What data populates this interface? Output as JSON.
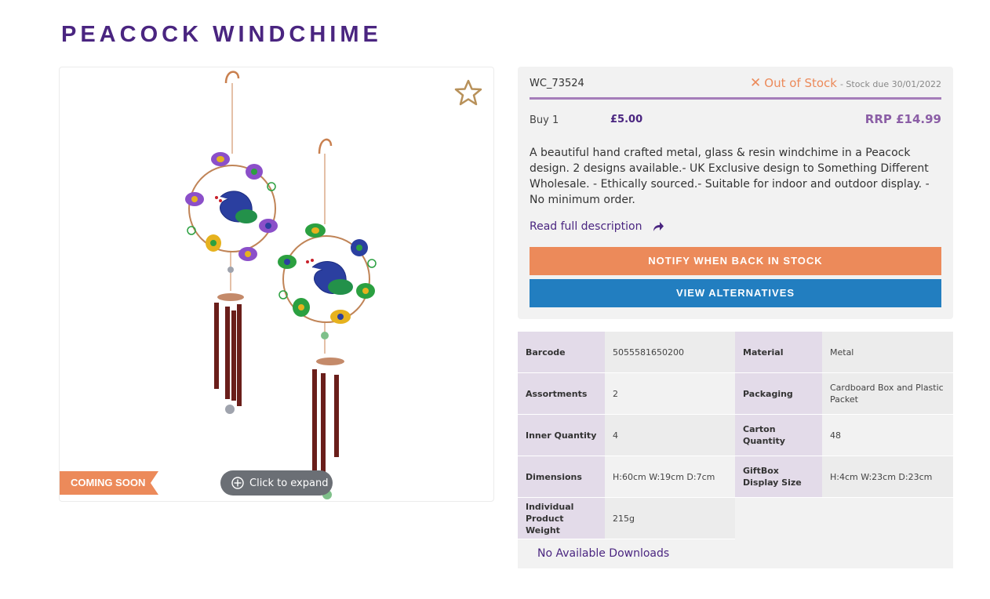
{
  "product": {
    "title": "PEACOCK WINDCHIME",
    "sku": "WC_73524",
    "stock_status": "Out of Stock",
    "stock_due": "- Stock due 30/01/2022",
    "buy_label": "Buy 1",
    "buy_price": "£5.00",
    "rrp": "RRP £14.99",
    "description": "A beautiful hand crafted metal, glass & resin windchime in a Peacock design. 2 designs available.- UK Exclusive design to Something Different Wholesale. - Ethically sourced.- Suitable for indoor and outdoor display. - No minimum order.",
    "read_more": "Read full description"
  },
  "image": {
    "badge": "COMING SOON",
    "expand_label": "Click to expand"
  },
  "buttons": {
    "notify": "NOTIFY WHEN BACK IN STOCK",
    "alternatives": "VIEW ALTERNATIVES"
  },
  "specs": {
    "barcode_label": "Barcode",
    "barcode": "5055581650200",
    "material_label": "Material",
    "material": "Metal",
    "assortments_label": "Assortments",
    "assortments": "2",
    "packaging_label": "Packaging",
    "packaging": "Cardboard Box and Plastic Packet",
    "inner_qty_label": "Inner Quantity",
    "inner_qty": "4",
    "carton_qty_label": "Carton Quantity",
    "carton_qty": "48",
    "dimensions_label": "Dimensions",
    "dimensions": "H:60cm W:19cm D:7cm",
    "giftbox_label": "GiftBox Display Size",
    "giftbox": "H:4cm W:23cm D:23cm",
    "weight_label": "Individual Product Weight",
    "weight": "215g"
  },
  "downloads": "No Available Downloads",
  "colors": {
    "brand_purple": "#4a2580",
    "accent_orange": "#ec8a5a",
    "accent_blue": "#227ec0",
    "rrp_purple": "#8b5ea6"
  },
  "icons": {
    "favorite": "star-outline-icon",
    "stock": "close-x-icon",
    "expand": "plus-circle-icon",
    "read_more": "share-arrow-icon"
  }
}
